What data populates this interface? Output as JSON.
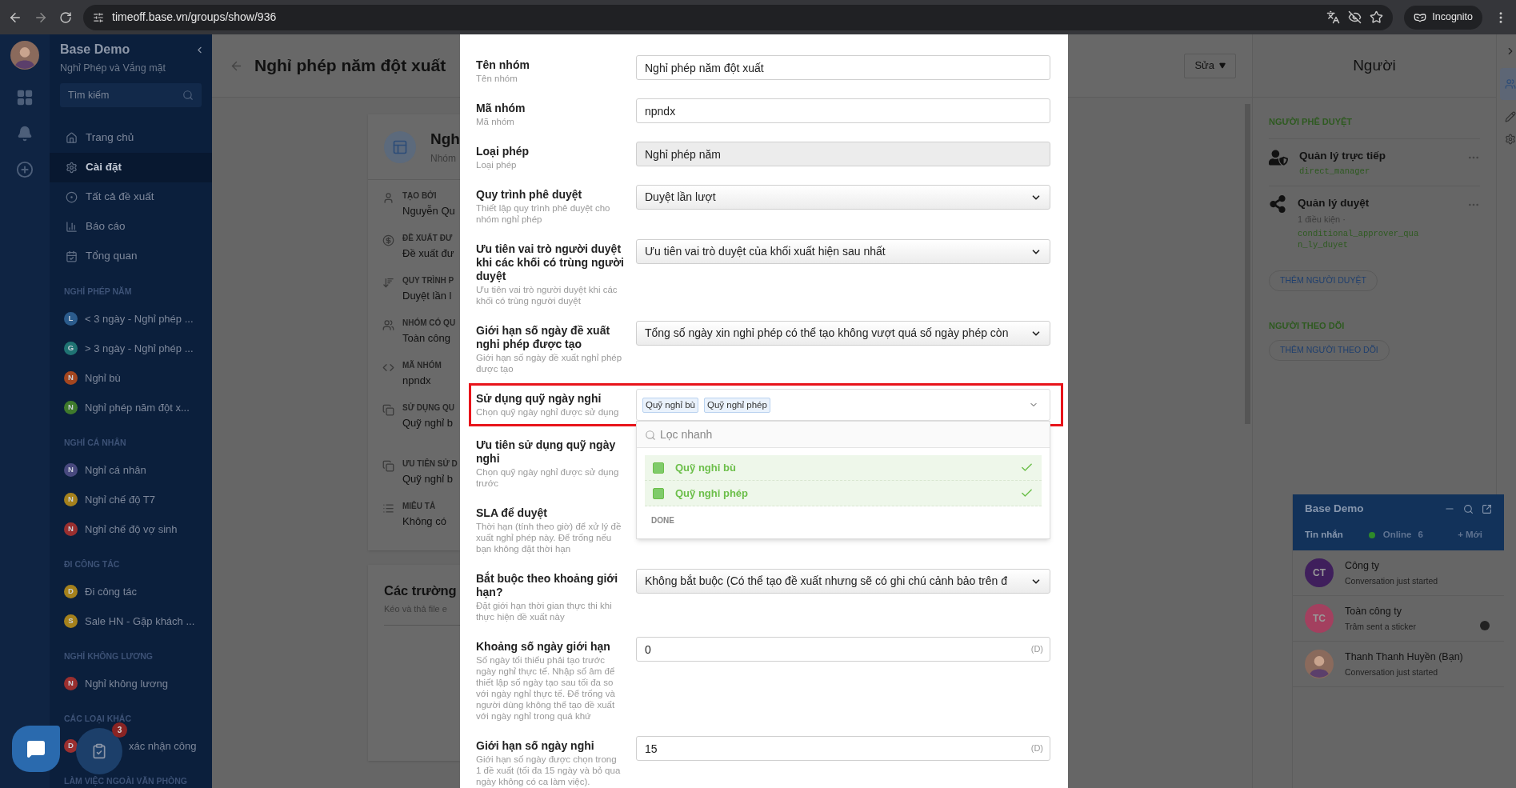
{
  "browser": {
    "url": "timeoff.base.vn/groups/show/936",
    "incognito": "Incognito"
  },
  "sidebar": {
    "title": "Base Demo",
    "subtitle": "Nghỉ Phép và Vắng mặt",
    "search_placeholder": "Tìm kiếm",
    "nav": [
      {
        "label": "Trang chủ",
        "selected": false
      },
      {
        "label": "Cài đặt",
        "selected": true
      },
      {
        "label": "Tất cả đề xuất",
        "selected": false
      },
      {
        "label": "Báo cáo",
        "selected": false
      },
      {
        "label": "Tổng quan",
        "selected": false
      }
    ],
    "sections": [
      {
        "title": "NGHỈ PHÉP NĂM",
        "items": [
          {
            "badge": "L",
            "label": "< 3 ngày - Nghỉ phép ...",
            "color": "#2b5b8c"
          },
          {
            "badge": "G",
            "label": "> 3 ngày - Nghỉ phép ...",
            "color": "#1f7373"
          },
          {
            "badge": "N",
            "label": "Nghỉ bù",
            "color": "#a4461f"
          },
          {
            "badge": "N",
            "label": "Nghỉ phép năm đột x...",
            "color": "#3f7a2c"
          }
        ]
      },
      {
        "title": "NGHỈ CÁ NHÂN",
        "items": [
          {
            "badge": "N",
            "label": "Nghỉ cá nhân",
            "color": "#48497f"
          },
          {
            "badge": "N",
            "label": "Nghỉ chế độ T7",
            "color": "#a5811c"
          },
          {
            "badge": "N",
            "label": "Nghỉ chế độ vợ sinh",
            "color": "#9a2f2f"
          }
        ]
      },
      {
        "title": "ĐI CÔNG TÁC",
        "items": [
          {
            "badge": "D",
            "label": "Đi công tác",
            "color": "#a5811c"
          },
          {
            "badge": "S",
            "label": "Sale HN - Gặp khách ...",
            "color": "#a5811c"
          }
        ]
      },
      {
        "title": "NGHỈ KHÔNG LƯƠNG",
        "items": [
          {
            "badge": "N",
            "label": "Nghỉ không lương",
            "color": "#9a2f2f"
          }
        ]
      },
      {
        "title": "CÁC LOẠI KHÁC",
        "items": [
          {
            "badge": "D",
            "label": "xác nhận công",
            "color": "#9a2f2f"
          }
        ]
      },
      {
        "title": "LÀM VIỆC NGOÀI VĂN PHÒNG"
      }
    ]
  },
  "floating": {
    "task_badge": "3"
  },
  "page": {
    "title": "Nghỉ phép năm đột xuất",
    "edit_button": "Sửa",
    "card": {
      "title": "Ngh",
      "subtitle": "Nhóm",
      "fields": [
        {
          "label": "TẠO BỞI",
          "value": "Nguyễn Qu"
        },
        {
          "label": "ĐỀ XUẤT ĐƯ",
          "value": "Đề xuất đư"
        },
        {
          "label": "QUY TRÌNH P",
          "value": "Duyệt lần l"
        },
        {
          "label": "NHÓM CÓ QU",
          "value": "Toàn công"
        },
        {
          "label": "MÃ NHÓM",
          "value": "npndx"
        },
        {
          "label": "SỬ DỤNG QU",
          "value": "Quỹ nghỉ b"
        },
        {
          "label": "ƯU TIÊN SỬ D",
          "value": "Quỹ nghỉ b"
        },
        {
          "label": "MIÊU TẢ",
          "value": "Không có"
        }
      ]
    },
    "fields_card": {
      "title": "Các trường",
      "subtitle": "Kéo và thả file e"
    }
  },
  "modal": {
    "rows": [
      {
        "label": "Tên nhóm",
        "description": "Tên nhóm",
        "field": {
          "kind": "text",
          "value": "Nghỉ phép năm đột xuất"
        }
      },
      {
        "label": "Mã nhóm",
        "description": "Mã nhóm",
        "field": {
          "kind": "text",
          "value": "npndx"
        }
      },
      {
        "label": "Loại phép",
        "description": "Loại phép",
        "field": {
          "kind": "readonly",
          "value": "Nghỉ phép năm"
        }
      },
      {
        "label": "Quy trình phê duyệt",
        "description": "Thiết lập quy trình phê duyệt cho nhóm nghỉ phép",
        "field": {
          "kind": "select",
          "value": "Duyệt lần lượt"
        }
      },
      {
        "label": "Ưu tiên vai trò người duyệt khi các khối có trùng người duyệt",
        "description": "Ưu tiên vai trò người duyệt khi các khối có trùng người duyệt",
        "field": {
          "kind": "select",
          "value": "Ưu tiên vai trò duyệt của khối xuất hiện sau nhất"
        }
      },
      {
        "label": "Giới hạn số ngày đề xuất nghỉ phép được tạo",
        "description": "Giới hạn số ngày đề xuất nghỉ phép được tạo",
        "field": {
          "kind": "select",
          "value": "Tổng số ngày xin nghỉ phép có thể tạo không vượt quá số ngày phép còn"
        }
      },
      {
        "label": "Sử dụng quỹ ngày nghỉ",
        "description": "Chọn quỹ ngày nghỉ được sử dụng",
        "field": {
          "kind": "multiselect",
          "tags": [
            "Quỹ nghỉ bù",
            "Quỹ nghỉ phép"
          ]
        }
      },
      {
        "label": "Ưu tiên sử dụng quỹ ngày nghỉ",
        "description": "Chọn quỹ ngày nghỉ được sử dụng trước"
      },
      {
        "label": "SLA để duyệt",
        "description": "Thời hạn (tính theo giờ) để xử lý đề xuất nghỉ phép này. Để trống nếu bạn không đặt thời hạn"
      },
      {
        "label": "Bắt buộc theo khoảng giới hạn?",
        "description": "Đặt giới hạn thời gian thực thi khi thực hiện đề xuất này",
        "field": {
          "kind": "select",
          "value": "Không bắt buộc (Có thể tạo đề xuất nhưng sẽ có ghi chú cảnh bảo trên đ"
        }
      },
      {
        "label": "Khoảng số ngày giới hạn",
        "description": "Số ngày tối thiểu phải tạo trước ngày nghỉ thực tế. Nhập số âm để thiết lập số ngày tạo sau tối đa so với ngày nghỉ thực tế. Để trống và người dùng không thể tạo đề xuất với ngày nghỉ trong quá khứ",
        "field": {
          "kind": "number",
          "value": "0",
          "unit": "(D)"
        }
      },
      {
        "label": "Giới hạn số ngày nghỉ",
        "description": "Giới hạn số ngày được chọn trong 1 đề xuất (tối đa 15 ngày và bỏ qua ngày không có ca làm việc).",
        "field": {
          "kind": "number",
          "value": "15",
          "unit": "(D)"
        }
      }
    ],
    "dropdown": {
      "placeholder": "Lọc nhanh",
      "options": [
        {
          "label": "Quỹ nghỉ bù",
          "checked": true
        },
        {
          "label": "Quỹ nghỉ phép",
          "checked": true
        }
      ],
      "done": "DONE"
    }
  },
  "people_panel": {
    "title": "Người",
    "approvers_title": "NGƯỜI PHÊ DUYỆT",
    "approvers": [
      {
        "kind": "manager",
        "name": "Quản lý trực tiếp",
        "code": "direct_manager"
      },
      {
        "kind": "conditional",
        "name": "Quản lý duyệt",
        "note": "1 điều kiện ·",
        "code": "conditional_approver_quan_ly_duyet"
      }
    ],
    "add_approver": "THÊM NGƯỜI DUYỆT",
    "followers_title": "NGƯỜI THEO DÕI",
    "add_follower": "THÊM NGƯỜI THEO DÕI"
  },
  "chat": {
    "title": "Base Demo",
    "messages_tab": "Tin nhắn",
    "online_label": "Online",
    "online_count": "6",
    "new_button": "+ Mới",
    "conversations": [
      {
        "kind": "initials",
        "initials": "CT",
        "color": "#3f1f5c",
        "name": "Công ty",
        "preview": "Conversation just started",
        "seen_marker": false
      },
      {
        "kind": "initials",
        "initials": "TC",
        "color": "#a3405f",
        "name": "Toàn công ty",
        "preview": "Trâm sent a sticker",
        "seen_marker": true
      },
      {
        "kind": "photo",
        "name": "Thanh Thanh Huyền (Bạn)",
        "preview": "Conversation just started",
        "seen_marker": false
      }
    ]
  }
}
